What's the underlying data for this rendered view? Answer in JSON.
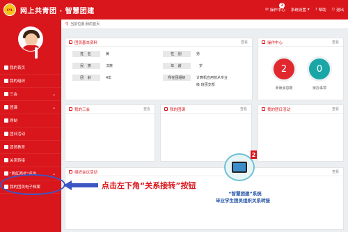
{
  "header": {
    "logo_text": "CYL",
    "title": "网上共青团 · 智慧团建",
    "actions": [
      {
        "label": "操作中心",
        "badge": "2"
      },
      {
        "label": "系统设置"
      },
      {
        "label": "帮助"
      },
      {
        "label": "退出"
      }
    ]
  },
  "sidebar": {
    "items": [
      {
        "label": "我的首页",
        "chevron": false
      },
      {
        "label": "我的组织",
        "chevron": false
      },
      {
        "label": "三会",
        "chevron": true
      },
      {
        "label": "团课",
        "chevron": true
      },
      {
        "label": "两制",
        "chevron": false
      },
      {
        "label": "团日活动",
        "chevron": false
      },
      {
        "label": "团员教育",
        "chevron": false
      },
      {
        "label": "关系转接",
        "chevron": false
      },
      {
        "label": "\"两红两优\"评选",
        "chevron": true
      },
      {
        "label": "我的团员电子档案",
        "chevron": false
      }
    ]
  },
  "breadcrumb": "当前位置:我的首页",
  "member_info": {
    "title": "团员基本资料",
    "more": "查看",
    "rows": [
      {
        "l1": "姓 名",
        "v1": "黄",
        "l2": "性 别",
        "v2": "男"
      },
      {
        "l1": "民 族",
        "v1": "汉族",
        "l2": "年 龄",
        "v2": "岁"
      },
      {
        "l1": "团 龄",
        "v1": "4年",
        "l2": "所在团组织",
        "v2": "计算机应用技术专业",
        "v2b": "级  班团支部"
      }
    ]
  },
  "ops_center": {
    "title": "操作中心",
    "more": "查看",
    "items": [
      {
        "value": "2",
        "label": "未读消息数",
        "color": "#e0282e"
      },
      {
        "value": "0",
        "label": "待办事项",
        "color": "#1aa6a6"
      }
    ]
  },
  "panels": [
    {
      "title": "我的三会",
      "more": "查看"
    },
    {
      "title": "我的团课",
      "more": "查看"
    },
    {
      "title": "我的团日活动",
      "more": "查看"
    }
  ],
  "meetings": {
    "title": "组织会议活动",
    "more": "查看"
  },
  "annotation": {
    "instruction": "点击左下角“关系接转”按钮",
    "promo_badge": "2",
    "promo_line1": "“智慧团建”系统",
    "promo_line2": "毕业学生团员组织关系转接"
  },
  "colors": {
    "brand": "#d9161c",
    "accent_blue": "#3c56c4",
    "teal": "#1aa6a6"
  }
}
